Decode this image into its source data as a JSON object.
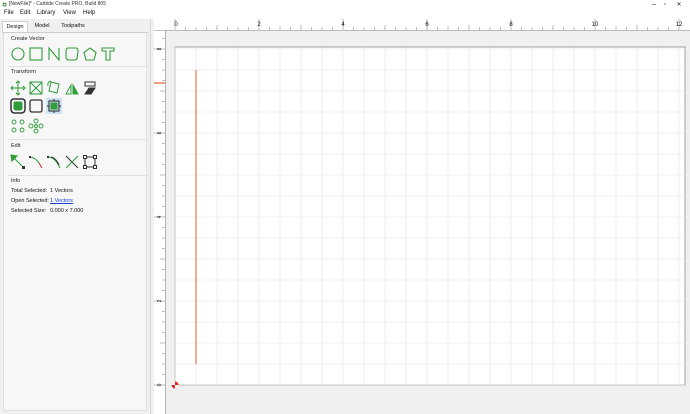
{
  "window": {
    "title": "[NewFile]* - Carbide Create PRO, Build 805",
    "minimize_glyph": "–",
    "maximize_glyph": "▫",
    "close_glyph": "✕"
  },
  "menu": [
    "File",
    "Edit",
    "Library",
    "View",
    "Help"
  ],
  "tabs": {
    "design": "Design",
    "model": "Model",
    "toolpaths": "Toolpaths",
    "active": "Design"
  },
  "sections": {
    "create_vector": "Create Vector",
    "transform": "Transform",
    "edit": "Edit",
    "info": "Info"
  },
  "tools": {
    "create_vector": [
      "circle-icon",
      "rectangle-icon",
      "polyline-icon",
      "rounded-rectangle-icon",
      "polygon-icon",
      "text-icon"
    ],
    "transform_row1": [
      "move-icon",
      "scale-icon",
      "rotate-icon",
      "mirror-icon",
      "align-icon"
    ],
    "transform_row2": [
      "offset-icon",
      "fillet-icon",
      "boolean-icon"
    ],
    "transform_row3": [
      "circular-array-icon",
      "rectangular-array-icon"
    ],
    "edit": [
      "node-edit-icon",
      "trim-icon",
      "join-icon",
      "split-icon",
      "bounding-box-icon"
    ]
  },
  "info": {
    "total_selected_label": "Total Selected:",
    "total_selected_value": "1 Vectors",
    "open_selected_label": "Open Selected:",
    "open_selected_value": "1 Vectors",
    "selected_size_label": "Selected Size:",
    "selected_size_value": "0.000 x 7.000"
  },
  "canvas": {
    "x_ruler_labels": [
      "0",
      "2",
      "4",
      "6",
      "8",
      "10",
      "12"
    ],
    "y_ruler_labels": [
      "8",
      "6",
      "4",
      "2",
      "0"
    ],
    "grid_color": "#e3e3e3",
    "vector_color": "#e8602c",
    "selected_vector": {
      "x": 0.5,
      "y_start": 0.5,
      "y_end": 7.5
    }
  },
  "colors": {
    "icon_green": "#2f9e3a",
    "link_blue": "#1a3fd1"
  }
}
